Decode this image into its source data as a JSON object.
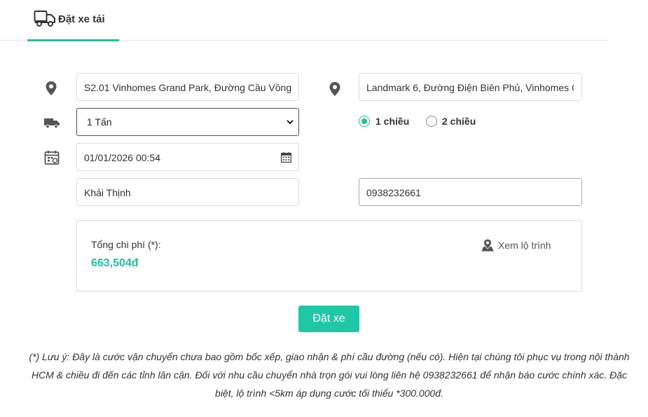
{
  "tabs": [
    {
      "label": "Đặt xe tải",
      "icon": "truck-icon",
      "active": true
    }
  ],
  "form": {
    "pickup": {
      "value": "S2.01 Vinhomes Grand Park, Đường Cầu Vồng",
      "icon": "map-pin-icon"
    },
    "dropoff": {
      "value": "Landmark 6, Đường Điện Biên Phủ, Vinhomes C",
      "icon": "map-pin-icon"
    },
    "vehicle": {
      "selected": "1 Tấn",
      "icon": "truck-small-icon"
    },
    "trip_type": {
      "options": [
        {
          "label": "1 chiều",
          "checked": true
        },
        {
          "label": "2 chiều",
          "checked": false
        }
      ]
    },
    "datetime": {
      "value": "01/01/2026 00:54",
      "icon": "calendar-icon"
    },
    "name": {
      "value": "Khải Thịnh"
    },
    "phone": {
      "value": "0938232661"
    }
  },
  "cost": {
    "label": "Tổng chi phí (*):",
    "value": "663,504đ",
    "route_link": "Xem lộ trình"
  },
  "book_button": "Đặt xe",
  "note": "(*) Lưu ý: Đây là cước vận chuyển chưa bao gồm bốc xếp, giao nhận & phí cầu đường (nếu có). Hiện tại chúng tôi phục vụ trong nội thành HCM & chiều đi đến các tỉnh lân cận. Đối với nhu cầu chuyển nhà trọn gói vui lòng liên hệ 0938232661 để nhận báo cước chính xác. Đặc biệt, lộ trình <5km áp dụng cước tối thiểu *300.000đ.",
  "colors": {
    "accent": "#1fbf9f",
    "button": "#20c7a6",
    "text": "#333333",
    "border": "#dcdcdc"
  }
}
